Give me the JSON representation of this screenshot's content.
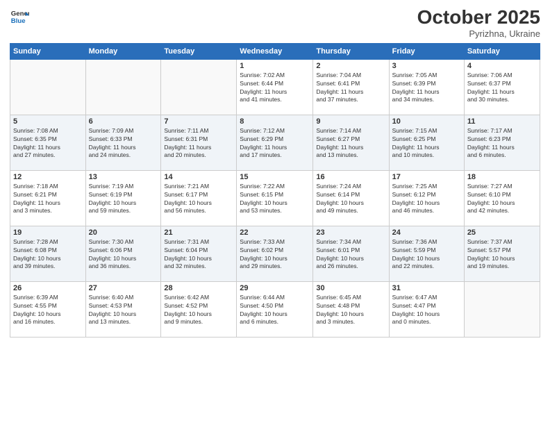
{
  "header": {
    "logo_line1": "General",
    "logo_line2": "Blue",
    "month": "October 2025",
    "location": "Pyrizhna, Ukraine"
  },
  "days_of_week": [
    "Sunday",
    "Monday",
    "Tuesday",
    "Wednesday",
    "Thursday",
    "Friday",
    "Saturday"
  ],
  "weeks": [
    [
      {
        "num": "",
        "info": ""
      },
      {
        "num": "",
        "info": ""
      },
      {
        "num": "",
        "info": ""
      },
      {
        "num": "1",
        "info": "Sunrise: 7:02 AM\nSunset: 6:44 PM\nDaylight: 11 hours\nand 41 minutes."
      },
      {
        "num": "2",
        "info": "Sunrise: 7:04 AM\nSunset: 6:41 PM\nDaylight: 11 hours\nand 37 minutes."
      },
      {
        "num": "3",
        "info": "Sunrise: 7:05 AM\nSunset: 6:39 PM\nDaylight: 11 hours\nand 34 minutes."
      },
      {
        "num": "4",
        "info": "Sunrise: 7:06 AM\nSunset: 6:37 PM\nDaylight: 11 hours\nand 30 minutes."
      }
    ],
    [
      {
        "num": "5",
        "info": "Sunrise: 7:08 AM\nSunset: 6:35 PM\nDaylight: 11 hours\nand 27 minutes."
      },
      {
        "num": "6",
        "info": "Sunrise: 7:09 AM\nSunset: 6:33 PM\nDaylight: 11 hours\nand 24 minutes."
      },
      {
        "num": "7",
        "info": "Sunrise: 7:11 AM\nSunset: 6:31 PM\nDaylight: 11 hours\nand 20 minutes."
      },
      {
        "num": "8",
        "info": "Sunrise: 7:12 AM\nSunset: 6:29 PM\nDaylight: 11 hours\nand 17 minutes."
      },
      {
        "num": "9",
        "info": "Sunrise: 7:14 AM\nSunset: 6:27 PM\nDaylight: 11 hours\nand 13 minutes."
      },
      {
        "num": "10",
        "info": "Sunrise: 7:15 AM\nSunset: 6:25 PM\nDaylight: 11 hours\nand 10 minutes."
      },
      {
        "num": "11",
        "info": "Sunrise: 7:17 AM\nSunset: 6:23 PM\nDaylight: 11 hours\nand 6 minutes."
      }
    ],
    [
      {
        "num": "12",
        "info": "Sunrise: 7:18 AM\nSunset: 6:21 PM\nDaylight: 11 hours\nand 3 minutes."
      },
      {
        "num": "13",
        "info": "Sunrise: 7:19 AM\nSunset: 6:19 PM\nDaylight: 10 hours\nand 59 minutes."
      },
      {
        "num": "14",
        "info": "Sunrise: 7:21 AM\nSunset: 6:17 PM\nDaylight: 10 hours\nand 56 minutes."
      },
      {
        "num": "15",
        "info": "Sunrise: 7:22 AM\nSunset: 6:15 PM\nDaylight: 10 hours\nand 53 minutes."
      },
      {
        "num": "16",
        "info": "Sunrise: 7:24 AM\nSunset: 6:14 PM\nDaylight: 10 hours\nand 49 minutes."
      },
      {
        "num": "17",
        "info": "Sunrise: 7:25 AM\nSunset: 6:12 PM\nDaylight: 10 hours\nand 46 minutes."
      },
      {
        "num": "18",
        "info": "Sunrise: 7:27 AM\nSunset: 6:10 PM\nDaylight: 10 hours\nand 42 minutes."
      }
    ],
    [
      {
        "num": "19",
        "info": "Sunrise: 7:28 AM\nSunset: 6:08 PM\nDaylight: 10 hours\nand 39 minutes."
      },
      {
        "num": "20",
        "info": "Sunrise: 7:30 AM\nSunset: 6:06 PM\nDaylight: 10 hours\nand 36 minutes."
      },
      {
        "num": "21",
        "info": "Sunrise: 7:31 AM\nSunset: 6:04 PM\nDaylight: 10 hours\nand 32 minutes."
      },
      {
        "num": "22",
        "info": "Sunrise: 7:33 AM\nSunset: 6:02 PM\nDaylight: 10 hours\nand 29 minutes."
      },
      {
        "num": "23",
        "info": "Sunrise: 7:34 AM\nSunset: 6:01 PM\nDaylight: 10 hours\nand 26 minutes."
      },
      {
        "num": "24",
        "info": "Sunrise: 7:36 AM\nSunset: 5:59 PM\nDaylight: 10 hours\nand 22 minutes."
      },
      {
        "num": "25",
        "info": "Sunrise: 7:37 AM\nSunset: 5:57 PM\nDaylight: 10 hours\nand 19 minutes."
      }
    ],
    [
      {
        "num": "26",
        "info": "Sunrise: 6:39 AM\nSunset: 4:55 PM\nDaylight: 10 hours\nand 16 minutes."
      },
      {
        "num": "27",
        "info": "Sunrise: 6:40 AM\nSunset: 4:53 PM\nDaylight: 10 hours\nand 13 minutes."
      },
      {
        "num": "28",
        "info": "Sunrise: 6:42 AM\nSunset: 4:52 PM\nDaylight: 10 hours\nand 9 minutes."
      },
      {
        "num": "29",
        "info": "Sunrise: 6:44 AM\nSunset: 4:50 PM\nDaylight: 10 hours\nand 6 minutes."
      },
      {
        "num": "30",
        "info": "Sunrise: 6:45 AM\nSunset: 4:48 PM\nDaylight: 10 hours\nand 3 minutes."
      },
      {
        "num": "31",
        "info": "Sunrise: 6:47 AM\nSunset: 4:47 PM\nDaylight: 10 hours\nand 0 minutes."
      },
      {
        "num": "",
        "info": ""
      }
    ]
  ]
}
